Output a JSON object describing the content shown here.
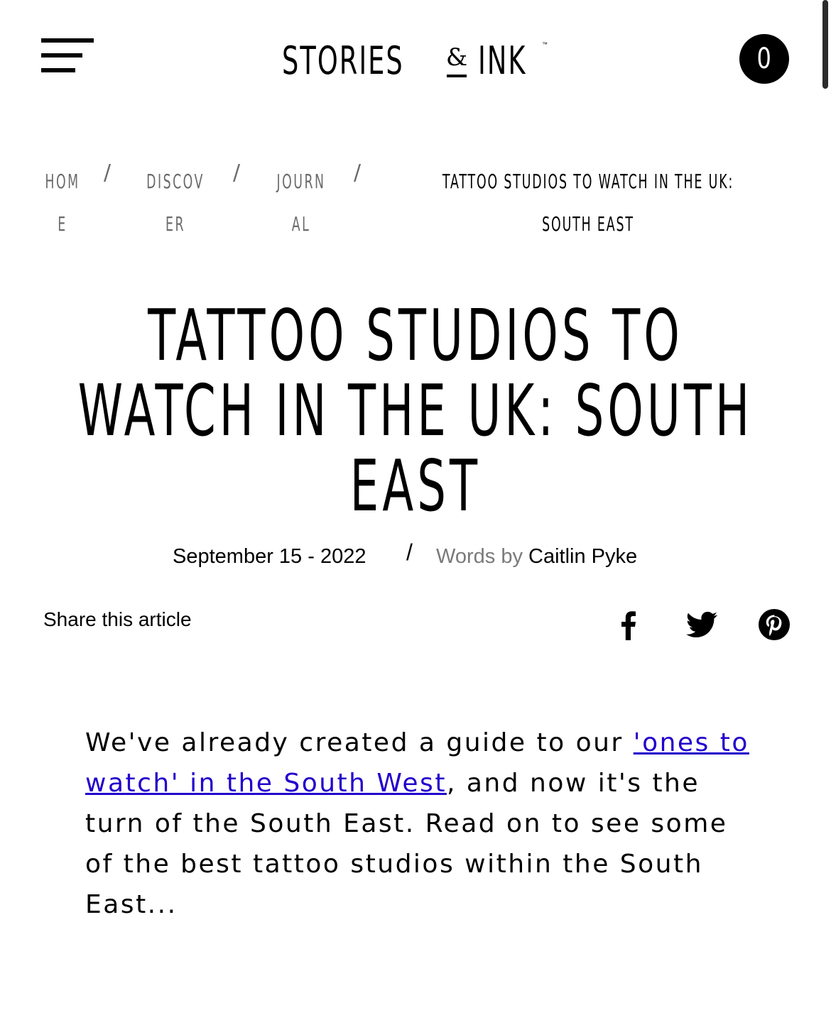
{
  "header": {
    "logo_left": "STORIES",
    "logo_amp": "&",
    "logo_right": "INK",
    "logo_tm": "™",
    "cart_count": "0"
  },
  "breadcrumb": {
    "items": [
      {
        "line1": "HOM",
        "line2": "E"
      },
      {
        "line1": "DISCOV",
        "line2": "ER"
      },
      {
        "line1": "JOURN",
        "line2": "AL"
      }
    ],
    "separator": "/",
    "current_line1": "TATTOO STUDIOS TO WATCH IN THE UK:",
    "current_line2": "SOUTH EAST"
  },
  "article": {
    "title_line1": "TATTOO STUDIOS TO",
    "title_line2": "WATCH IN THE UK: SOUTH",
    "title_line3": "EAST",
    "date": "September 15 - 2022",
    "meta_separator": "/",
    "words_by": "Words by",
    "author": "Caitlin Pyke",
    "share_label": "Share this article",
    "intro_before_link": "We've already created a guide to our ",
    "intro_link": "'ones to watch' in the South West",
    "intro_after_link": ", and now it's the turn of the South East. Read on to see some of the best tattoo studios within the South East..."
  },
  "share": {
    "icons": [
      "facebook-icon",
      "twitter-icon",
      "pinterest-icon"
    ]
  },
  "colors": {
    "link": "#2200cc",
    "muted": "#6b6b6b",
    "text": "#000000",
    "background": "#ffffff"
  }
}
